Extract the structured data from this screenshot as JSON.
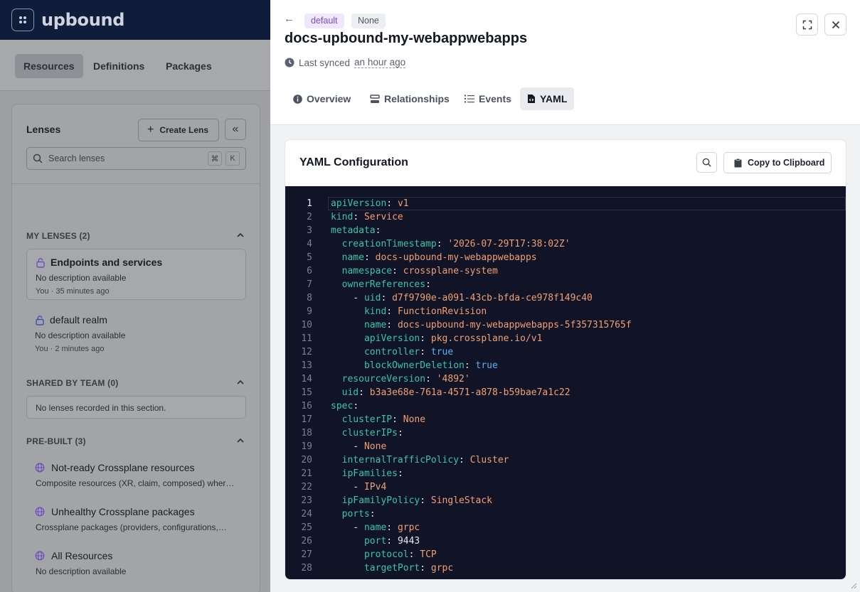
{
  "app": {
    "logo_text": "upbound"
  },
  "nav": {
    "tabs": [
      "Resources",
      "Definitions",
      "Packages"
    ],
    "active": "Resources"
  },
  "lenses": {
    "title": "Lenses",
    "create_label": "Create Lens",
    "search_placeholder": "Search lenses",
    "shortcut_keys": [
      "⌘",
      "K"
    ],
    "my_lenses": {
      "header": "MY LENSES (2)",
      "items": [
        {
          "title": "Endpoints and services",
          "description": "No description available",
          "owner": "You",
          "time": "35 minutes ago"
        },
        {
          "title": "default realm",
          "description": "No description available",
          "owner": "You",
          "time": "2 minutes ago"
        }
      ]
    },
    "shared": {
      "header": "SHARED BY TEAM (0)",
      "empty_text": "No lenses recorded in this section."
    },
    "prebuilt": {
      "header": "PRE-BUILT (3)",
      "items": [
        {
          "title": "Not-ready Crossplane resources",
          "description": "Composite resources (XR, claim, composed) wher…"
        },
        {
          "title": "Unhealthy Crossplane packages",
          "description": "Crossplane packages (providers, configurations,…"
        },
        {
          "title": "All Resources",
          "description": "No description available"
        }
      ]
    }
  },
  "drawer": {
    "namespace_badge": "default",
    "status_badge": "None",
    "title": "docs-upbound-my-webappwebapps",
    "synced_prefix": "Last synced",
    "synced_ago": "an hour ago",
    "tabs": [
      {
        "label": "Overview",
        "icon": "info-icon"
      },
      {
        "label": "Relationships",
        "icon": "relationships-icon"
      },
      {
        "label": "Events",
        "icon": "list-icon"
      },
      {
        "label": "YAML",
        "icon": "file-code-icon"
      }
    ],
    "active_tab": "YAML",
    "yaml": {
      "title": "YAML Configuration",
      "copy_label": "Copy to Clipboard",
      "lines": [
        {
          "n": "1",
          "indent": "",
          "key": "apiVersion",
          "val": "v1",
          "vt": "s"
        },
        {
          "n": "2",
          "indent": "",
          "key": "kind",
          "val": "Service",
          "vt": "s"
        },
        {
          "n": "3",
          "indent": "",
          "key": "metadata",
          "val": "",
          "vt": ""
        },
        {
          "n": "4",
          "indent": "  ",
          "key": "creationTimestamp",
          "val": "'2026-07-29T17:38:02Z'",
          "vt": "s"
        },
        {
          "n": "5",
          "indent": "  ",
          "key": "name",
          "val": "docs-upbound-my-webappwebapps",
          "vt": "s"
        },
        {
          "n": "6",
          "indent": "  ",
          "key": "namespace",
          "val": "crossplane-system",
          "vt": "s"
        },
        {
          "n": "7",
          "indent": "  ",
          "key": "ownerReferences",
          "val": "",
          "vt": ""
        },
        {
          "n": "8",
          "indent": "    - ",
          "key": "uid",
          "val": "d7f9790e-a091-43cb-bfda-ce978f149c40",
          "vt": "s"
        },
        {
          "n": "9",
          "indent": "      ",
          "key": "kind",
          "val": "FunctionRevision",
          "vt": "s"
        },
        {
          "n": "10",
          "indent": "      ",
          "key": "name",
          "val": "docs-upbound-my-webappwebapps-5f357315765f",
          "vt": "s"
        },
        {
          "n": "11",
          "indent": "      ",
          "key": "apiVersion",
          "val": "pkg.crossplane.io/v1",
          "vt": "s"
        },
        {
          "n": "12",
          "indent": "      ",
          "key": "controller",
          "val": "true",
          "vt": "b"
        },
        {
          "n": "13",
          "indent": "      ",
          "key": "blockOwnerDeletion",
          "val": "true",
          "vt": "b"
        },
        {
          "n": "14",
          "indent": "  ",
          "key": "resourceVersion",
          "val": "'4892'",
          "vt": "s"
        },
        {
          "n": "15",
          "indent": "  ",
          "key": "uid",
          "val": "b3a3e68e-761a-4571-a878-b59bae7a1c22",
          "vt": "s"
        },
        {
          "n": "16",
          "indent": "",
          "key": "spec",
          "val": "",
          "vt": ""
        },
        {
          "n": "17",
          "indent": "  ",
          "key": "clusterIP",
          "val": "None",
          "vt": "s"
        },
        {
          "n": "18",
          "indent": "  ",
          "key": "clusterIPs",
          "val": "",
          "vt": ""
        },
        {
          "n": "19",
          "indent": "    - ",
          "key": "",
          "val": "None",
          "vt": "s"
        },
        {
          "n": "20",
          "indent": "  ",
          "key": "internalTrafficPolicy",
          "val": "Cluster",
          "vt": "s"
        },
        {
          "n": "21",
          "indent": "  ",
          "key": "ipFamilies",
          "val": "",
          "vt": ""
        },
        {
          "n": "22",
          "indent": "    - ",
          "key": "",
          "val": "IPv4",
          "vt": "s"
        },
        {
          "n": "23",
          "indent": "  ",
          "key": "ipFamilyPolicy",
          "val": "SingleStack",
          "vt": "s"
        },
        {
          "n": "24",
          "indent": "  ",
          "key": "ports",
          "val": "",
          "vt": ""
        },
        {
          "n": "25",
          "indent": "    - ",
          "key": "name",
          "val": "grpc",
          "vt": "s"
        },
        {
          "n": "26",
          "indent": "      ",
          "key": "port",
          "val": "9443",
          "vt": "n"
        },
        {
          "n": "27",
          "indent": "      ",
          "key": "protocol",
          "val": "TCP",
          "vt": "s"
        },
        {
          "n": "28",
          "indent": "      ",
          "key": "targetPort",
          "val": "grpc",
          "vt": "s"
        }
      ]
    }
  }
}
